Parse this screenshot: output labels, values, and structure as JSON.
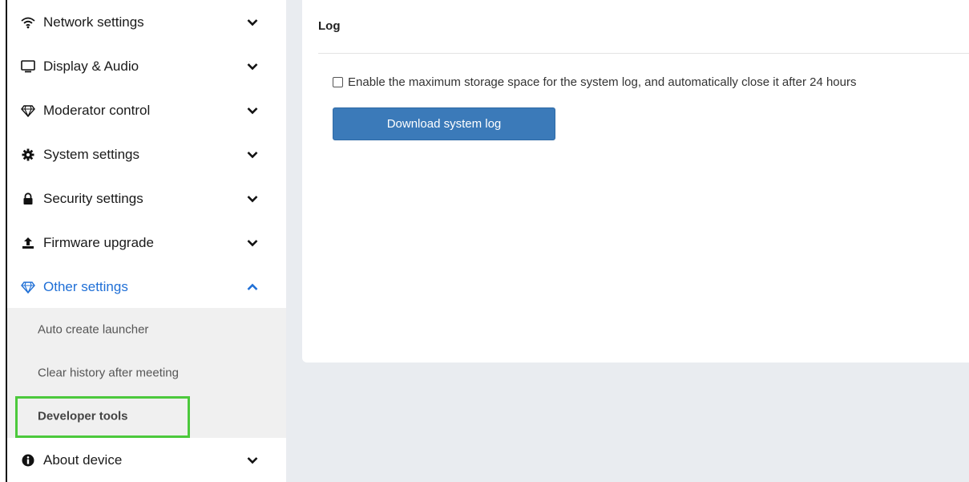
{
  "sidebar": {
    "items": [
      {
        "label": "Network settings",
        "icon": "wifi-icon"
      },
      {
        "label": "Display & Audio",
        "icon": "monitor-icon"
      },
      {
        "label": "Moderator control",
        "icon": "diamond-icon"
      },
      {
        "label": "System settings",
        "icon": "gear-icon"
      },
      {
        "label": "Security settings",
        "icon": "lock-icon"
      },
      {
        "label": "Firmware upgrade",
        "icon": "upload-icon"
      },
      {
        "label": "Other settings",
        "icon": "diamond-icon",
        "expanded": true
      },
      {
        "label": "About device",
        "icon": "info-icon"
      }
    ],
    "submenu": [
      {
        "label": "Auto create launcher"
      },
      {
        "label": "Clear history after meeting"
      },
      {
        "label": "Developer tools",
        "selected": true
      }
    ]
  },
  "main": {
    "title": "Log",
    "checkbox_label": "Enable the maximum storage space for the system log, and automatically close it after 24 hours",
    "checkbox_checked": false,
    "download_button": "Download system log"
  },
  "colors": {
    "accent": "#1f6fd6",
    "button": "#3b7ab9",
    "highlight": "#4cc93c",
    "background": "#e9ecf0"
  }
}
